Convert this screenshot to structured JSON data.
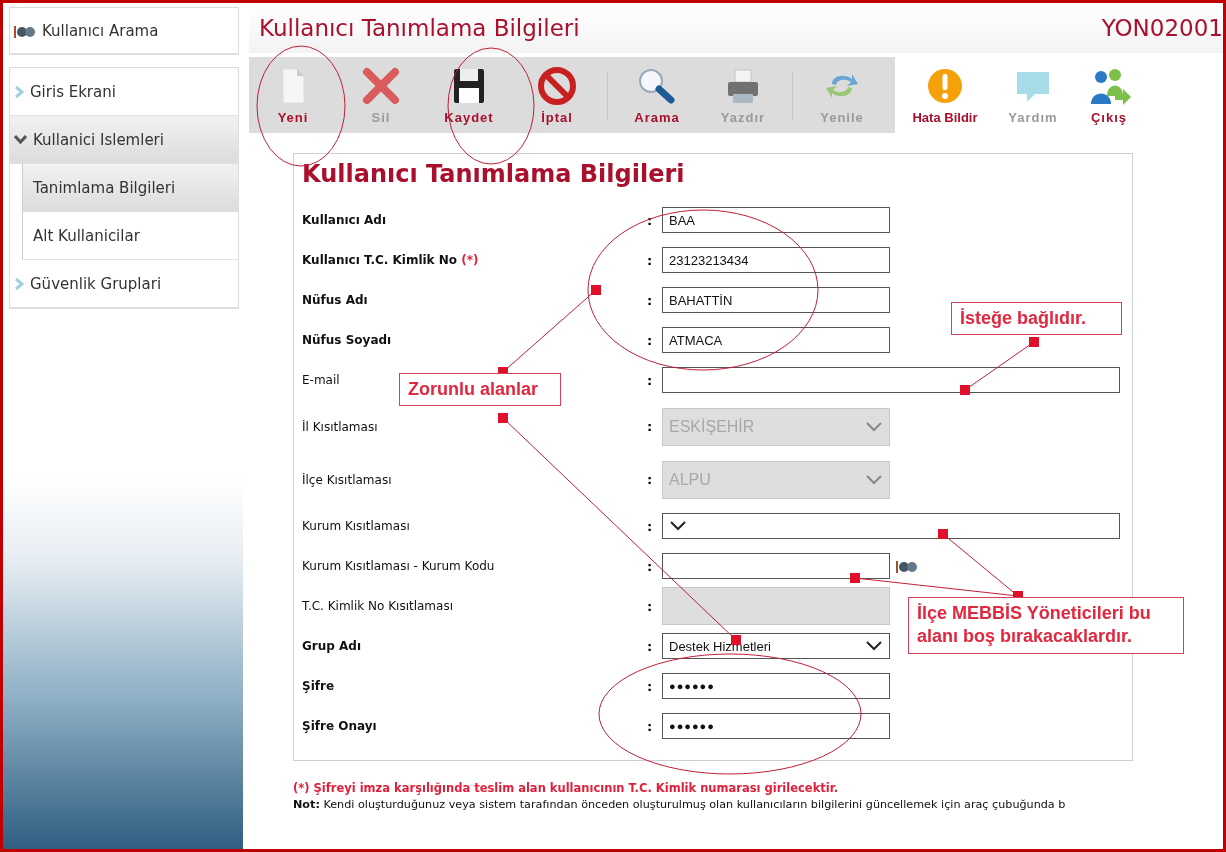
{
  "sidebar": {
    "search_link": {
      "label": "Kullanıcı Arama"
    },
    "items": [
      {
        "label": "Giris Ekrani",
        "expanded": false
      },
      {
        "label": "Kullanici Islemleri",
        "expanded": true,
        "children": [
          {
            "label": "Tanimlama Bilgileri",
            "selected": true
          },
          {
            "label": "Alt Kullanicilar",
            "selected": false
          }
        ]
      },
      {
        "label": "Güvenlik Gruplari",
        "expanded": false
      }
    ]
  },
  "header": {
    "title": "Kullanıcı Tanımlama Bilgileri",
    "code": "YON02001"
  },
  "toolbar": {
    "groups": [
      {
        "items": [
          {
            "label": "Yeni",
            "kind": "new",
            "enabled": true
          },
          {
            "label": "Sil",
            "kind": "delete",
            "enabled": false
          },
          {
            "label": "Kaydet",
            "kind": "save",
            "enabled": true
          },
          {
            "label": "İptal",
            "kind": "cancel",
            "enabled": true
          }
        ]
      },
      {
        "items": [
          {
            "label": "Arama",
            "kind": "search",
            "enabled": true
          },
          {
            "label": "Yazdır",
            "kind": "print",
            "enabled": false
          }
        ]
      },
      {
        "items": [
          {
            "label": "Yenile",
            "kind": "refresh",
            "enabled": false
          }
        ]
      }
    ],
    "extras": [
      {
        "label": "Hata Bildir",
        "kind": "report",
        "enabled": true
      },
      {
        "label": "Yardım",
        "kind": "help",
        "enabled": false
      },
      {
        "label": "Çıkış",
        "kind": "exit",
        "enabled": true
      }
    ]
  },
  "form": {
    "title": "Kullanıcı Tanımlama Bilgileri",
    "fields": [
      {
        "label": "Kullanıcı Adı",
        "separator": ":",
        "bold": true,
        "kind": "text",
        "value": "BAA",
        "disabled": false,
        "wide": false
      },
      {
        "label": "Kullanıcı T.C. Kimlik No",
        "marker": "(*)",
        "separator": ":",
        "bold": true,
        "kind": "text",
        "value": "23123213434",
        "disabled": false,
        "wide": false
      },
      {
        "label": "Nüfus Adı",
        "separator": ":",
        "bold": true,
        "kind": "text",
        "value": "BAHATTİN",
        "disabled": false,
        "wide": false
      },
      {
        "label": "Nüfus Soyadı",
        "separator": ":",
        "bold": true,
        "kind": "text",
        "value": "ATMACA",
        "disabled": false,
        "wide": false
      },
      {
        "label": "E-mail",
        "separator": ":",
        "bold": false,
        "kind": "text",
        "disabled": false,
        "wide": true
      },
      {
        "label": "İl Kısıtlaması",
        "separator": ":",
        "bold": false,
        "kind": "select",
        "value": "ESKİŞEHİR",
        "disabled": true,
        "wide": false
      },
      {
        "label": "İlçe Kısıtlaması",
        "separator": ":",
        "bold": false,
        "kind": "select",
        "value": "ALPU",
        "disabled": true,
        "wide": false
      },
      {
        "label": "Kurum Kısıtlaması",
        "separator": ":",
        "bold": false,
        "kind": "select",
        "disabled": false,
        "wide": true
      },
      {
        "label": "Kurum Kısıtlaması - Kurum Kodu",
        "separator": ":",
        "bold": false,
        "kind": "lookup",
        "disabled": false,
        "wide": false
      },
      {
        "label": "T.C. Kimlik No Kısıtlaması",
        "separator": ":",
        "bold": false,
        "kind": "text",
        "disabled": true,
        "wide": false
      },
      {
        "label": "Grup Adı",
        "separator": ":",
        "bold": true,
        "kind": "select",
        "value": "Destek Hizmetleri",
        "disabled": false,
        "wide": false
      },
      {
        "label": "Şifre",
        "separator": ":",
        "bold": true,
        "kind": "password",
        "value": "●●●●●●",
        "disabled": false,
        "wide": false
      },
      {
        "label": "Şifre Onayı",
        "separator": ":",
        "bold": true,
        "kind": "password",
        "value": "●●●●●●",
        "disabled": false,
        "wide": false
      }
    ]
  },
  "notes": {
    "required": "(*) Şifreyi imza karşılığında teslim alan kullanıcının T.C. Kimlik numarası girilecektir.",
    "note": "**Not:** Kendi oluşturduğunuz veya sistem tarafından önceden oluşturulmuş olan kullanıcıların bilgilerini güncellemek için araç çubuğunda b"
  },
  "callouts": [
    {
      "text": "Zorunlu alanlar"
    },
    {
      "text": "İsteğe bağlıdır."
    },
    {
      "text": "İlçe MEBBİS Yöneticileri bu alanı boş bırakacaklardır."
    }
  ]
}
